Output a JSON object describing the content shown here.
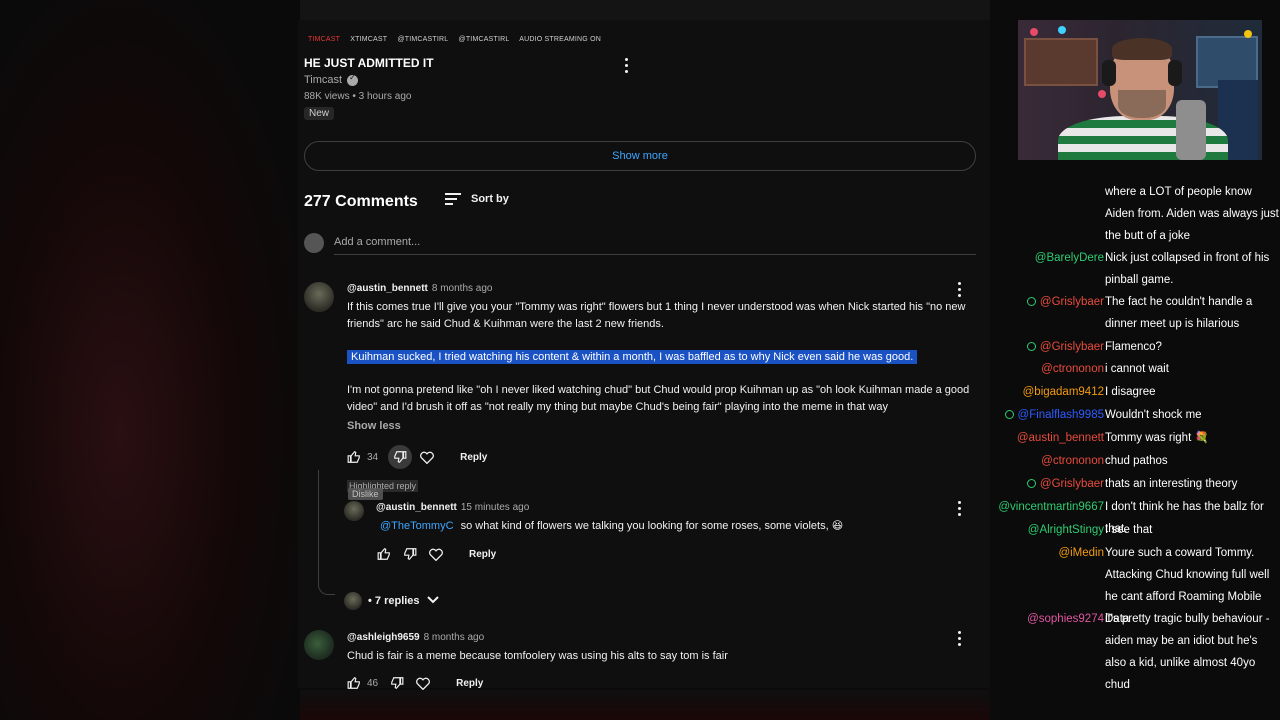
{
  "video": {
    "ticker": [
      "TIMCAST",
      "XTIMCAST",
      "@TIMCASTIRL",
      "@TIMCASTIRL",
      "AUDIO STREAMING ON"
    ],
    "title": "HE JUST ADMITTED IT",
    "channel": "Timcast",
    "views_time": "88K views • 3 hours ago",
    "badge": "New",
    "show_more": "Show more"
  },
  "comments": {
    "count_label": "277 Comments",
    "sort_label": "Sort by",
    "add_placeholder": "Add a comment...",
    "items": [
      {
        "user": "@austin_bennett",
        "time": "8 months ago",
        "text1": "If this comes true I'll give you your \"Tommy was right\" flowers but 1 thing I never understood was when Nick started his \"no new friends\" arc he said Chud & Kuihman were the last 2 new friends.",
        "text2": "Kuihman sucked, I tried watching his content & within a month, I was baffled as to why Nick even said he was good.",
        "text3": "I'm not gonna pretend like \"oh I never liked watching chud\" but Chud would prop Kuihman up as \"oh look Kuihman made a good video\" and I'd brush it off as \"not really my thing but maybe Chud's being fair\" playing into the meme in that way",
        "show_less": "Show less",
        "likes": "34",
        "reply": "Reply"
      },
      {
        "user": "@ashleigh9659",
        "time": "8 months ago",
        "text": "Chud is fair is a meme because tomfoolery was using his alts to say tom is fair",
        "likes": "46",
        "reply": "Reply"
      }
    ],
    "highlighted_reply": {
      "label": "Highlighted reply",
      "tooltip": "Dislike",
      "user": "@austin_bennett",
      "time": "15 minutes ago",
      "mention": "@TheTommyC",
      "text": "so what kind of flowers we talking you looking for some roses, some violets, 😆",
      "reply": "Reply"
    },
    "replies_toggle": "• 7 replies"
  },
  "chat": [
    {
      "name": "",
      "message": "where a LOT of people know Aiden from. Aiden was always just the butt of a joke",
      "color": "#ffffff",
      "badge": false
    },
    {
      "name": "@BarelyDere",
      "message": "Nick just collapsed in front of his pinball game.",
      "color": "#2ecc71",
      "badge": false
    },
    {
      "name": "@Grislybaer",
      "message": "The fact he couldn't handle a dinner meet up is hilarious",
      "color": "#e74c3c",
      "badge": true
    },
    {
      "name": "@Grislybaer",
      "message": "Flamenco?",
      "color": "#e74c3c",
      "badge": true
    },
    {
      "name": "@ctrononon",
      "message": "i cannot wait",
      "color": "#e74c3c",
      "badge": false
    },
    {
      "name": "@bigadam9412",
      "message": "I disagree",
      "color": "#f39c12",
      "badge": false
    },
    {
      "name": "@Finalflash9985",
      "message": "Wouldn't shock me",
      "color": "#2e5bff",
      "badge": true
    },
    {
      "name": "@austin_bennett",
      "message": "Tommy was right 💐",
      "color": "#e74c3c",
      "badge": false
    },
    {
      "name": "@ctrononon",
      "message": "chud pathos",
      "color": "#e74c3c",
      "badge": false
    },
    {
      "name": "@Grislybaer",
      "message": "thats an interesting theory",
      "color": "#e74c3c",
      "badge": true
    },
    {
      "name": "@vincentmartin9667",
      "message": "I don't think he has the ballz for that.",
      "color": "#2ecc71",
      "badge": false
    },
    {
      "name": "@AlrightStingy",
      "message": "I see that",
      "color": "#2ecc71",
      "badge": false
    },
    {
      "name": "@iMedin",
      "message": "Youre such a coward Tommy. Attacking Chud knowing full well he cant afford Roaming Mobile Data",
      "color": "#f39c12",
      "badge": false
    },
    {
      "name": "@sophies9274",
      "message": "it's pretty tragic bully behaviour - aiden may be an idiot but he's also a kid, unlike almost 40yo chud",
      "color": "#e056a0",
      "badge": false
    }
  ]
}
